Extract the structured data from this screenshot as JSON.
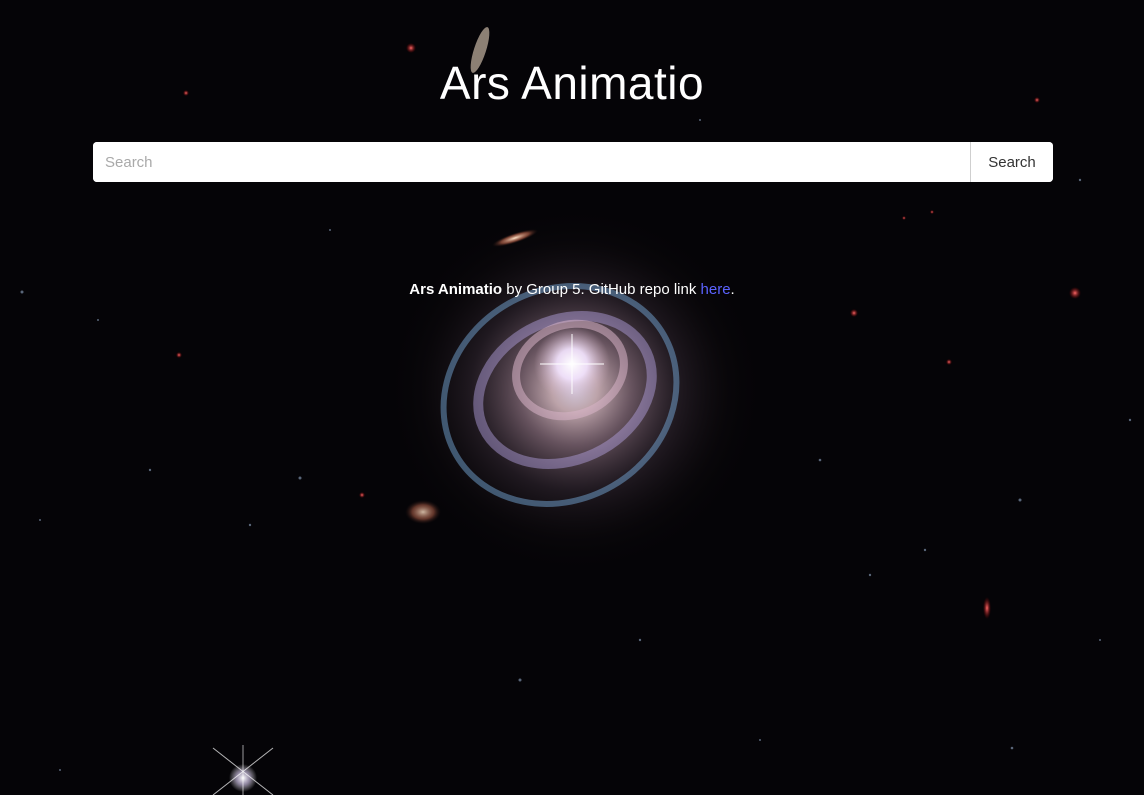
{
  "page": {
    "title": "Ars Animatio"
  },
  "search": {
    "placeholder": "Search",
    "value": "",
    "button_label": "Search"
  },
  "footer": {
    "project_name": "Ars Animatio",
    "text_middle": " by Group 5. GitHub repo link ",
    "link_label": "here",
    "text_end": "."
  },
  "colors": {
    "background": "#050407",
    "link": "#5b63ff",
    "text": "#ffffff"
  }
}
